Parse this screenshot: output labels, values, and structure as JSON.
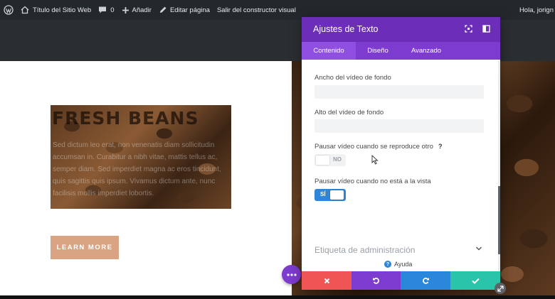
{
  "admin_bar": {
    "site_title": "Título del Sitio Web",
    "comments_count": "0",
    "add_new": "Añadir",
    "edit_page": "Editar página",
    "exit_builder": "Salir del constructor visual",
    "greeting": "Hola, jorign"
  },
  "content": {
    "heading": "FRESH BEANS",
    "body_text": "Sed dictum leo erat, non venenatis diam sollicitudin accumsan in. Curabitur a nibh vitae, mattis tellus ac, semper diam. Sed imperdiet magna ac eros tincidunt, quis sagittis quis ipsum. Vivamus dictum ante, nunc facilisis mollis imperdiet lobortis.",
    "button_label": "LEARN MORE"
  },
  "panel": {
    "title": "Ajustes de Texto",
    "tabs": [
      {
        "label": "Contenido",
        "active": true
      },
      {
        "label": "Diseño",
        "active": false
      },
      {
        "label": "Avanzado",
        "active": false
      }
    ],
    "fields": {
      "video_width_label": "Ancho del vídeo de fondo",
      "video_height_label": "Alto del vídeo de fondo",
      "pause_other_label": "Pausar vídeo cuando se reproduce otro",
      "pause_other_toggle": "NO",
      "pause_offscreen_label": "Pausar vídeo cuando no está a la vista",
      "pause_offscreen_toggle": "SÍ",
      "help_mark": "?"
    },
    "admin_label_section": "Etiqueta de administración",
    "help_link": "Ayuda",
    "help_circle": "?"
  },
  "colors": {
    "panel_header": "#6c2eb9",
    "panel_tabs": "#7d3bcf",
    "toggle_on": "#2e86d8",
    "close": "#ef5555",
    "undo": "#7d3bcf",
    "redo": "#2b87da",
    "save": "#29c4a9",
    "button": "#d9a482"
  },
  "icons": {
    "admin_bar": [
      "wordpress-icon",
      "home-icon",
      "comment-icon",
      "plus-icon",
      "edit-icon"
    ],
    "panel_header": [
      "expand-icon",
      "sidebar-toggle-icon"
    ],
    "footer": [
      "close-icon",
      "undo-icon",
      "redo-icon",
      "check-icon"
    ],
    "other": [
      "more-dots-icon",
      "chevron-down-icon",
      "resize-icon",
      "cursor-icon"
    ]
  }
}
